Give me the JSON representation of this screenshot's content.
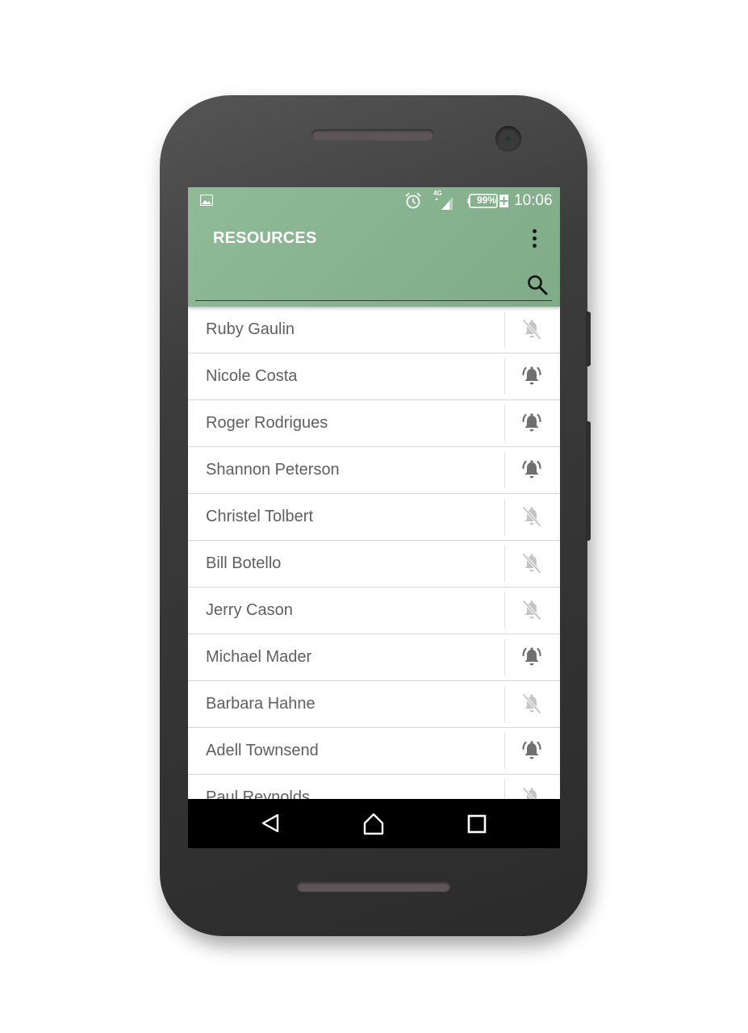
{
  "status_bar": {
    "time": "10:06",
    "battery": "99%",
    "network": "4G",
    "icons": [
      "image-icon",
      "alarm-icon",
      "signal-icon",
      "battery-icon"
    ]
  },
  "app_bar": {
    "title": "RESOURCES",
    "search": {
      "value": "",
      "placeholder": ""
    },
    "color": "#86b38d"
  },
  "resources": [
    {
      "name": "Ruby Gaulin",
      "alarm": "off"
    },
    {
      "name": "Nicole Costa",
      "alarm": "on"
    },
    {
      "name": "Roger Rodrigues",
      "alarm": "on"
    },
    {
      "name": "Shannon Peterson",
      "alarm": "on"
    },
    {
      "name": "Christel Tolbert",
      "alarm": "off"
    },
    {
      "name": "Bill Botello",
      "alarm": "off"
    },
    {
      "name": "Jerry Cason",
      "alarm": "off"
    },
    {
      "name": "Michael Mader",
      "alarm": "on"
    },
    {
      "name": "Barbara Hahne",
      "alarm": "off"
    },
    {
      "name": "Adell Townsend",
      "alarm": "on"
    },
    {
      "name": "Paul Reynolds",
      "alarm": "off"
    }
  ],
  "colors": {
    "bell_on": "#6f6f6f",
    "bell_off": "#c4c4c4",
    "text": "#5f5f5f"
  },
  "nav_bar": {
    "buttons": [
      "back-icon",
      "home-icon",
      "recent-apps-icon"
    ]
  }
}
